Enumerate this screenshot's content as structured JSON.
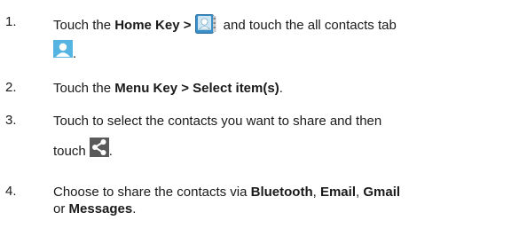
{
  "steps": [
    {
      "number": "1.",
      "pre": "Touch the ",
      "bold1": "Home Key >",
      "post": " and touch the all contacts tab",
      "end": "."
    },
    {
      "number": "2.",
      "pre": "Touch the ",
      "bold1": "Menu Key > Select item(s)",
      "end": "."
    },
    {
      "number": "3.",
      "line1": "Touch to select the contacts you want to share and then",
      "line2": "touch",
      "end": "."
    },
    {
      "number": "4.",
      "pre": "Choose to share the contacts via ",
      "bt": "Bluetooth",
      "comma1": ", ",
      "email": "Email",
      "comma2": ", ",
      "gmail": "Gmail",
      "or": "or ",
      "messages": "Messages",
      "end": "."
    }
  ],
  "icons": {
    "contacts_app": "contacts-app-icon",
    "contacts_tab": "contacts-tab-icon",
    "share": "share-icon"
  },
  "colors": {
    "text": "#1a1a1a",
    "icon_blue": "#4aa6d8",
    "share_bg": "#5a5a5a"
  }
}
